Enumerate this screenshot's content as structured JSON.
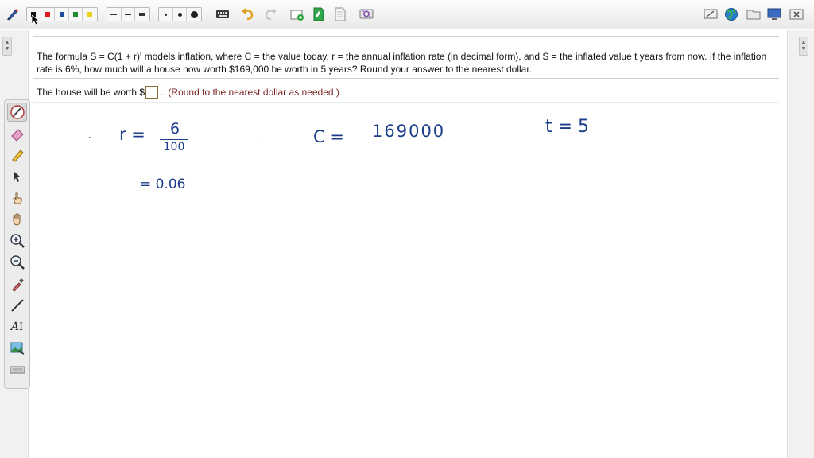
{
  "toolbar": {
    "tools": [
      "pen-tool-icon"
    ],
    "colors": [
      "#111111",
      "#e01b1b",
      "#1d4c9c",
      "#1e8c2c",
      "#e8d21a"
    ],
    "line_styles": [
      "thin",
      "medium",
      "thick"
    ],
    "dot_sizes": [
      "small",
      "medium",
      "large"
    ],
    "right_icons": [
      "monitor-icon",
      "globe-icon",
      "folder-icon",
      "screen-icon",
      "close-icon"
    ]
  },
  "question": {
    "formula_prefix": "The formula S = C(1 + r)",
    "formula_exponent": "t",
    "text": " models inflation, where C = the value today, r = the annual inflation rate (in decimal form), and S = the inflated value t years from now.  If the inflation rate is 6%, how much will a house now worth $169,000 be worth in 5 years? Round your answer to the nearest dollar."
  },
  "answer": {
    "prefix": "The house will be worth $",
    "suffix": ".",
    "hint": "(Round to the nearest dollar as needed.)",
    "value": ""
  },
  "notes": {
    "r_label": "r =",
    "r_numerator": "6",
    "r_denominator": "100",
    "r_decimal": "= 0.06",
    "c_label": "C =",
    "c_value": "169000",
    "t_label": "t = 5"
  },
  "colors": {
    "ink": "#1c3d8a",
    "hint": "#7a2323"
  }
}
